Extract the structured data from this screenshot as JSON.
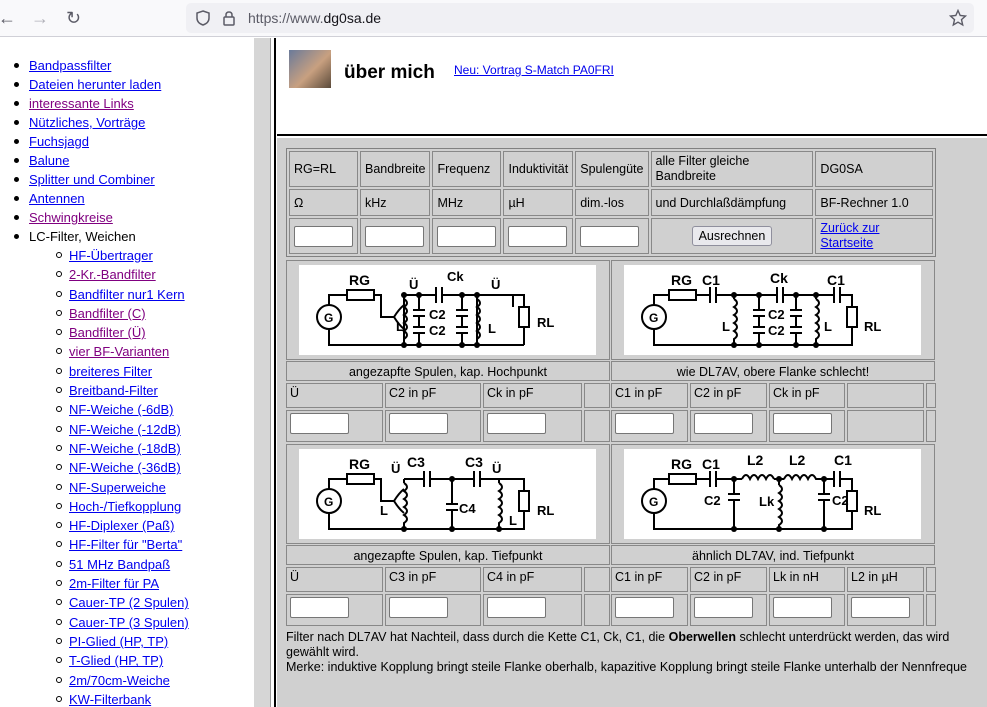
{
  "browser": {
    "url_proto": "https://www.",
    "url_host": "dg0sa.de"
  },
  "sidebar": {
    "items": [
      {
        "label": "Bandpassfilter",
        "state": "link"
      },
      {
        "label": "Dateien herunter laden",
        "state": "link"
      },
      {
        "label": "interessante Links",
        "state": "visited"
      },
      {
        "label": "Nützliches, Vorträge",
        "state": "link"
      },
      {
        "label": "Fuchsjagd",
        "state": "link"
      },
      {
        "label": "Balune",
        "state": "link"
      },
      {
        "label": "Splitter und Combiner",
        "state": "link"
      },
      {
        "label": "Antennen",
        "state": "link"
      },
      {
        "label": "Schwingkreise",
        "state": "visited"
      },
      {
        "label": "LC-Filter, Weichen",
        "state": "plain"
      }
    ],
    "subitems": [
      {
        "label": "HF-Übertrager",
        "state": "link"
      },
      {
        "label": "2-Kr.-Bandfilter",
        "state": "visited"
      },
      {
        "label": "Bandfilter nur1 Kern",
        "state": "link"
      },
      {
        "label": "Bandfilter (C)",
        "state": "visited"
      },
      {
        "label": "Bandfilter (Ü)",
        "state": "visited"
      },
      {
        "label": "vier BF-Varianten",
        "state": "visited"
      },
      {
        "label": "breiteres Filter",
        "state": "link"
      },
      {
        "label": "Breitband-Filter",
        "state": "link"
      },
      {
        "label": "NF-Weiche (-6dB)",
        "state": "link"
      },
      {
        "label": "NF-Weiche (-12dB)",
        "state": "link"
      },
      {
        "label": "NF-Weiche (-18dB)",
        "state": "link"
      },
      {
        "label": "NF-Weiche (-36dB)",
        "state": "link"
      },
      {
        "label": "NF-Superweiche",
        "state": "link"
      },
      {
        "label": "Hoch-/Tiefkopplung",
        "state": "link"
      },
      {
        "label": "HF-Diplexer (Paß)",
        "state": "link"
      },
      {
        "label": "HF-Filter für \"Berta\"",
        "state": "link"
      },
      {
        "label": "51 MHz Bandpaß",
        "state": "link"
      },
      {
        "label": "2m-Filter für PA",
        "state": "link"
      },
      {
        "label": "Cauer-TP (2 Spulen)",
        "state": "link"
      },
      {
        "label": "Cauer-TP (3 Spulen)",
        "state": "link"
      },
      {
        "label": "PI-Glied (HP, TP)",
        "state": "link"
      },
      {
        "label": "T-Glied (HP, TP)",
        "state": "link"
      },
      {
        "label": "2m/70cm-Weiche",
        "state": "link"
      },
      {
        "label": "KW-Filterbank",
        "state": "link"
      }
    ]
  },
  "header": {
    "title": "über mich",
    "new_link": "Neu: Vortrag S-Match PA0FRI"
  },
  "calc": {
    "headers": [
      "RG=RL",
      "Bandbreite",
      "Frequenz",
      "Induktivität",
      "Spulengüte",
      "alle Filter gleiche Bandbreite",
      "DG0SA"
    ],
    "units": [
      "Ω",
      "kHz",
      "MHz",
      "µH",
      "dim.-los",
      "und Durchlaßdämpfung",
      "BF-Rechner 1.0"
    ],
    "button": "Ausrechnen",
    "back_link": "Zurück zur Startseite"
  },
  "circuits": {
    "p1": {
      "caption": "angezapfte Spulen, kap. Hochpunkt",
      "fields": [
        "Ü",
        "C2 in pF",
        "Ck in pF"
      ],
      "labels": {
        "rg": "RG",
        "u1": "Ü",
        "ck": "Ck",
        "u2": "Ü",
        "l1": "L",
        "c2a": "C2",
        "c2b": "C2",
        "l2": "L",
        "rl": "RL",
        "g": "G"
      }
    },
    "p2": {
      "caption": "wie DL7AV, obere Flanke schlecht!",
      "fields": [
        "C1 in pF",
        "C2 in pF",
        "Ck in pF"
      ],
      "labels": {
        "rg": "RG",
        "c1a": "C1",
        "ck": "Ck",
        "c1b": "C1",
        "l1": "L",
        "c2a": "C2",
        "c2b": "C2",
        "l2": "L",
        "rl": "RL",
        "g": "G"
      }
    },
    "p3": {
      "caption": "angezapfte Spulen, kap. Tiefpunkt",
      "fields": [
        "Ü",
        "C3 in pF",
        "C4 in pF"
      ],
      "labels": {
        "rg": "RG",
        "u1": "Ü",
        "c3a": "C3",
        "c3b": "C3",
        "u2": "Ü",
        "l1": "L",
        "c4": "C4",
        "l2": "L",
        "rl": "RL",
        "g": "G"
      }
    },
    "p4": {
      "caption": "ähnlich DL7AV, ind. Tiefpunkt",
      "fields": [
        "C1 in pF",
        "C2 in pF",
        "Lk in nH",
        "L2 in µH"
      ],
      "labels": {
        "rg": "RG",
        "c1a": "C1",
        "l2a": "L2",
        "l2b": "L2",
        "c1b": "C1",
        "c2a": "C2",
        "lk": "Lk",
        "c2b": "C2",
        "rl": "RL",
        "g": "G"
      }
    }
  },
  "notes": {
    "line1a": "Filter nach DL7AV hat Nachteil, dass durch die Kette C1, Ck, C1, die ",
    "line1b": "Oberwellen",
    "line1c": " schlecht unterdrückt werden, das wird",
    "line2": "gewählt wird.",
    "line3": "Merke: induktive Kopplung bringt steile Flanke oberhalb, kapazitive Kopplung bringt steile Flanke unterhalb der Nennfreque"
  }
}
